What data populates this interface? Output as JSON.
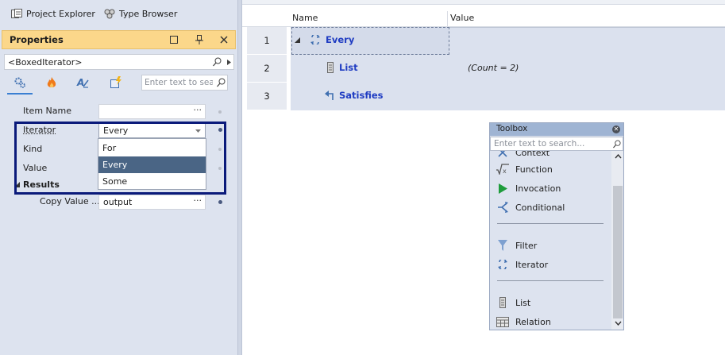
{
  "tabs": {
    "project_explorer": "Project Explorer",
    "type_browser": "Type Browser"
  },
  "properties": {
    "title": "Properties",
    "selector_value": "<BoxedIterator>",
    "search_placeholder": "Enter text to sea",
    "rows": {
      "item_name": {
        "label": "Item Name",
        "value": ""
      },
      "iterator": {
        "label": "Iterator",
        "value": "Every"
      },
      "kind": {
        "label": "Kind"
      },
      "value": {
        "label": "Value"
      },
      "results": {
        "label": "Results"
      },
      "copy_value": {
        "label": "Copy Value ...",
        "value": "output"
      }
    },
    "iterator_options": [
      "For",
      "Every",
      "Some"
    ],
    "iterator_selected": "Every"
  },
  "grid": {
    "columns": {
      "name": "Name",
      "value": "Value"
    },
    "rows": [
      {
        "num": "1",
        "name": "Every",
        "value": ""
      },
      {
        "num": "2",
        "name": "List",
        "value": "(Count = 2)"
      },
      {
        "num": "3",
        "name": "Satisfies",
        "value": ""
      }
    ]
  },
  "toolbox": {
    "title": "Toolbox",
    "search_placeholder": "Enter text to search...",
    "partial_item": "Context",
    "items": [
      "Function",
      "Invocation",
      "Conditional",
      "Filter",
      "Iterator",
      "List",
      "Relation"
    ]
  },
  "colors": {
    "accent_title": "#fbd78a",
    "node_text": "#1f3cc2",
    "selected_option": "#4a6585",
    "highlight_border": "#0a1a7a"
  }
}
